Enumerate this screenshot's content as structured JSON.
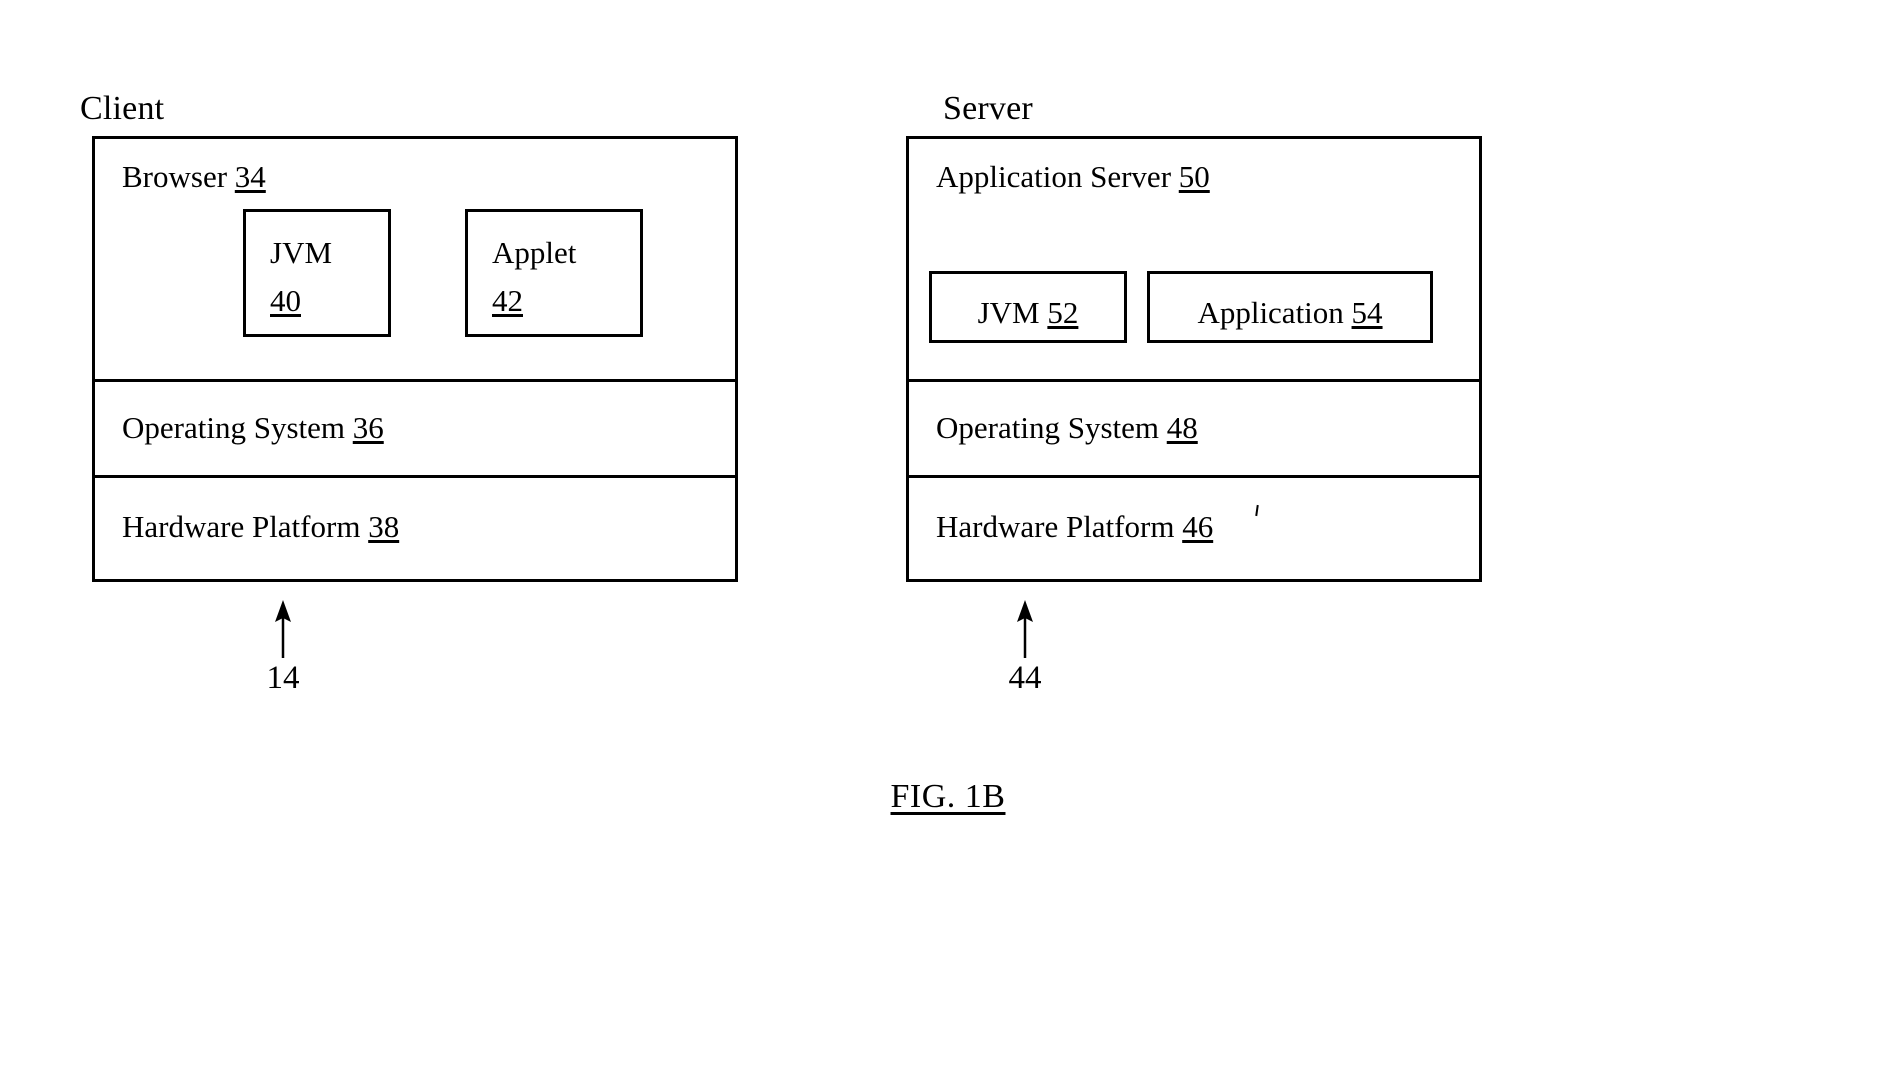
{
  "figure": {
    "caption": "FIG. 1B"
  },
  "client": {
    "heading": "Client",
    "layers": [
      {
        "name": "browser",
        "label_text": "Browser ",
        "label_ref": "34",
        "components": [
          {
            "name": "jvm",
            "line1": "JVM",
            "line2_ref": "40"
          },
          {
            "name": "applet",
            "line1": "Applet",
            "line2_ref": "42"
          }
        ]
      },
      {
        "name": "operating-system",
        "label_text": "Operating System ",
        "label_ref": "36"
      },
      {
        "name": "hardware-platform",
        "label_text": "Hardware Platform ",
        "label_ref": "38"
      }
    ],
    "pointer_number": "14"
  },
  "server": {
    "heading": "Server",
    "layers": [
      {
        "name": "application-server",
        "label_text": "Application Server ",
        "label_ref": "50",
        "components": [
          {
            "name": "jvm",
            "text": "JVM ",
            "ref": "52"
          },
          {
            "name": "application",
            "text": "Application ",
            "ref": "54"
          }
        ]
      },
      {
        "name": "operating-system",
        "label_text": "Operating System ",
        "label_ref": "48"
      },
      {
        "name": "hardware-platform",
        "label_text": "Hardware Platform ",
        "label_ref": "46"
      }
    ],
    "pointer_number": "44"
  },
  "colors": {
    "ink": "#000000",
    "paper": "#ffffff"
  }
}
